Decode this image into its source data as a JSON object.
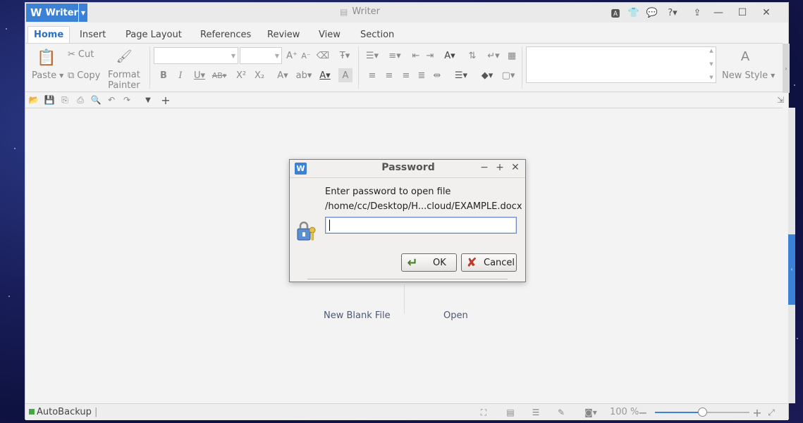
{
  "app": {
    "name": "Writer",
    "window_title": "Writer"
  },
  "tabs": [
    "Home",
    "Insert",
    "Page Layout",
    "References",
    "Review",
    "View",
    "Section"
  ],
  "active_tab": "Home",
  "ribbon": {
    "paste_label": "Paste",
    "cut_label": "Cut",
    "copy_label": "Copy",
    "format_painter_label_1": "Format",
    "format_painter_label_2": "Painter",
    "new_style_label": "New Style",
    "font_name_value": "",
    "font_size_value": ""
  },
  "start_page": {
    "new_blank_file": "New Blank File",
    "open": "Open"
  },
  "dialog": {
    "title": "Password",
    "prompt": "Enter password to open file",
    "file_path": "/home/cc/Desktop/H...cloud/EXAMPLE.docx",
    "password_value": "",
    "ok_label": "OK",
    "cancel_label": "Cancel"
  },
  "statusbar": {
    "autobackup_label": "AutoBackup",
    "zoom_label": "100 %",
    "zoom_fraction": 0.5
  },
  "colors": {
    "accent": "#3b82d6",
    "autobackup_dot": "#43a842"
  },
  "icons": {
    "title_bar": [
      "skin-icon",
      "shirt-icon",
      "chat-icon",
      "help-icon",
      "upload-icon",
      "minimize-icon",
      "maximize-icon",
      "close-icon"
    ],
    "quick_access": [
      "open-folder-icon",
      "save-icon",
      "export-pdf-icon",
      "print-icon",
      "print-preview-icon",
      "undo-icon",
      "redo-icon",
      "customize-dropdown-icon",
      "add-icon"
    ]
  }
}
